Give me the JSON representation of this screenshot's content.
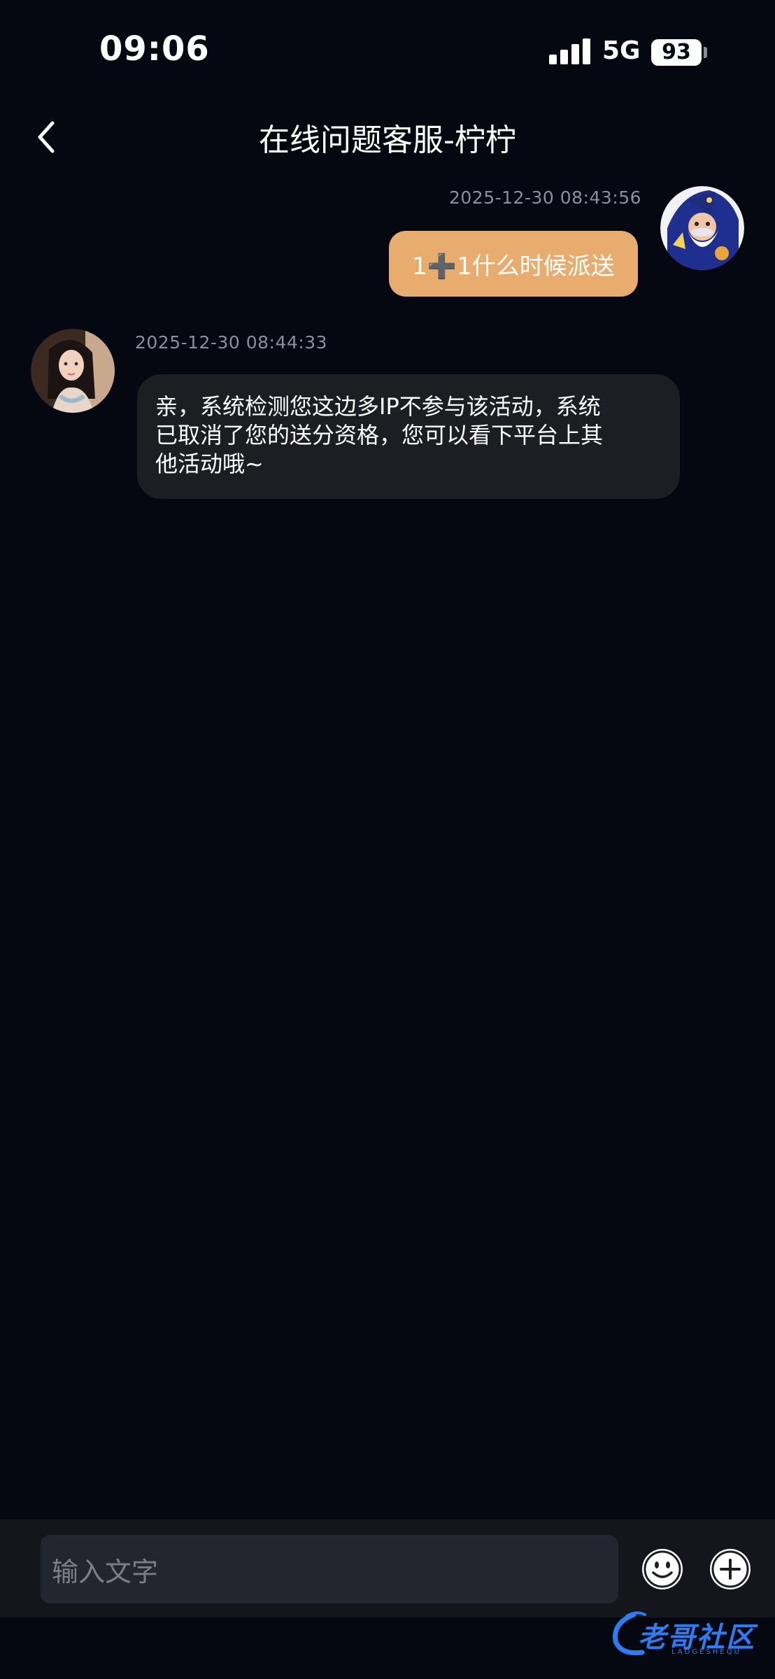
{
  "status_bar": {
    "time": "09:06",
    "network": "5G",
    "battery": "93"
  },
  "header": {
    "title": "在线问题客服-柠柠"
  },
  "messages": [
    {
      "direction": "outgoing",
      "timestamp": "2025-12-30 08:43:56",
      "text": "1➕1什么时候派送"
    },
    {
      "direction": "incoming",
      "timestamp": "2025-12-30 08:44:33",
      "lines": [
        "亲，系统检测您这边多IP不参与该活动，系统",
        "已取消了您的送分资格，您可以看下平台上其",
        "他活动哦~"
      ]
    }
  ],
  "input": {
    "placeholder": "输入文字"
  },
  "watermark": {
    "text": "老哥社区",
    "sub": "LAOGESHEQU"
  },
  "colors": {
    "background": "#050811",
    "outgoing_bubble": "#e8ad6e",
    "incoming_bubble": "#1c1e24",
    "input_bar": "#14161c",
    "timestamp": "#8a8f9c"
  },
  "icons": {
    "back": "chevron-left-icon",
    "emoji": "smiley-icon",
    "add": "plus-circle-icon"
  }
}
